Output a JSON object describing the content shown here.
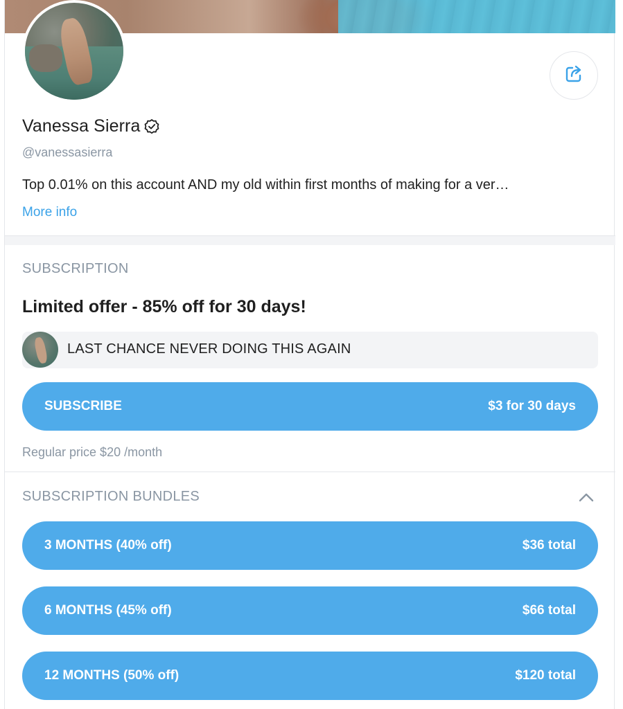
{
  "profile": {
    "name": "Vanessa Sierra",
    "handle": "@vanessasierra",
    "bio": "Top 0.01% on this account AND my old within first months of making for a ver…",
    "more_info": "More info"
  },
  "subscription": {
    "section_title": "SUBSCRIPTION",
    "offer_title": "Limited offer - 85% off for 30 days!",
    "promo_message": "LAST CHANCE NEVER DOING THIS AGAIN",
    "subscribe_label": "SUBSCRIBE",
    "subscribe_price": "$3 for 30 days",
    "regular_price": "Regular price $20 /month"
  },
  "bundles": {
    "section_title": "SUBSCRIPTION BUNDLES",
    "items": [
      {
        "label": "3 MONTHS (40% off)",
        "price": "$36 total"
      },
      {
        "label": "6 MONTHS (45% off)",
        "price": "$66 total"
      },
      {
        "label": "12 MONTHS (50% off)",
        "price": "$120 total"
      }
    ]
  },
  "icons": {
    "share": "share-icon",
    "verified": "verified-badge-icon",
    "collapse": "chevron-up-icon"
  },
  "colors": {
    "accent": "#4fabea",
    "link": "#3aa2e8",
    "muted_text": "#8a96a3",
    "promo_bg": "#f3f4f6"
  }
}
